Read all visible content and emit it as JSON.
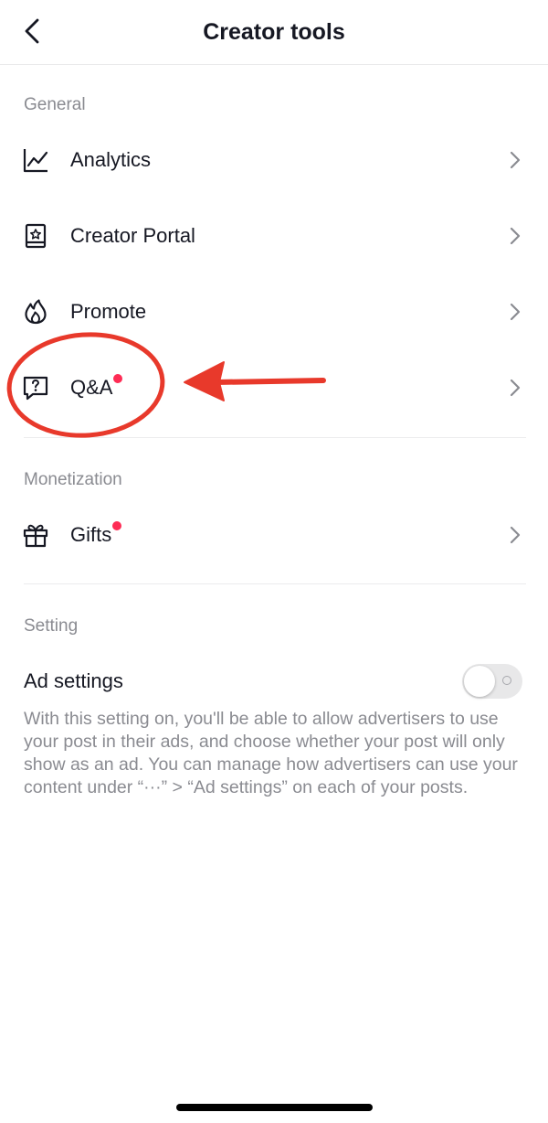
{
  "header": {
    "title": "Creator tools",
    "back_icon": "chevron-left-icon"
  },
  "sections": {
    "general": {
      "label": "General",
      "items": [
        {
          "label": "Analytics",
          "icon": "analytics-chart-icon",
          "has_dot": false
        },
        {
          "label": "Creator Portal",
          "icon": "creator-portal-book-icon",
          "has_dot": false
        },
        {
          "label": "Promote",
          "icon": "flame-icon",
          "has_dot": false
        },
        {
          "label": "Q&A",
          "icon": "question-bubble-icon",
          "has_dot": true
        }
      ]
    },
    "monetization": {
      "label": "Monetization",
      "items": [
        {
          "label": "Gifts",
          "icon": "gift-icon",
          "has_dot": true
        }
      ]
    },
    "setting": {
      "label": "Setting",
      "ad_settings": {
        "title": "Ad settings",
        "enabled": false,
        "description": "With this setting on, you'll be able to allow advertisers to use your post in their ads, and choose whether your post will only show as an ad. You can manage how advertisers can use your content under “···” > “Ad settings” on each of your posts."
      }
    }
  },
  "colors": {
    "notification_dot": "#fe2c55",
    "annotation": "#e8392b",
    "secondary_text": "#8a8b91",
    "primary_text": "#161823"
  }
}
